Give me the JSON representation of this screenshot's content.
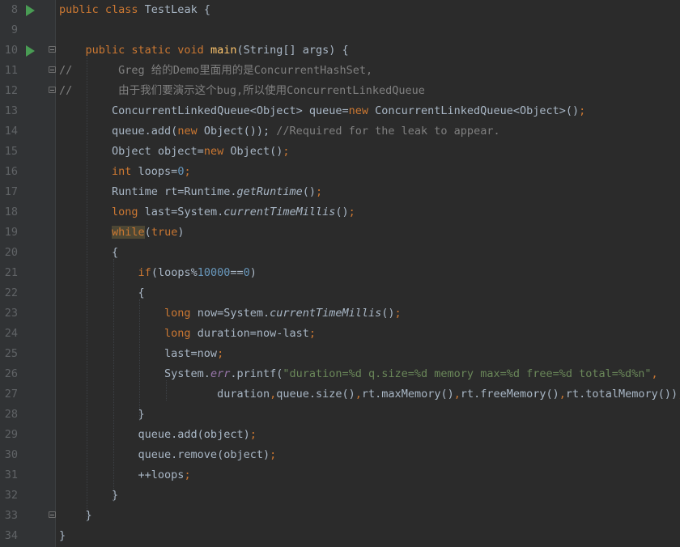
{
  "editor": {
    "colors": {
      "background": "#2b2b2b",
      "gutter": "#313335",
      "keyword": "#cc7832",
      "method": "#ffc66d",
      "number": "#6897bb",
      "string": "#6a8759",
      "comment": "#808080",
      "field": "#9876aa",
      "text": "#a9b7c6",
      "line_number": "#606366",
      "run_icon": "#499c54"
    },
    "lines": [
      {
        "num": "8",
        "parts": [
          [
            "kw",
            "public class "
          ],
          [
            "",
            "TestLeak {"
          ]
        ]
      },
      {
        "num": "9",
        "parts": []
      },
      {
        "num": "10",
        "parts": [
          [
            "",
            "    "
          ],
          [
            "kw",
            "public static void "
          ],
          [
            "fn",
            "main"
          ],
          [
            "",
            "(String[] args) {"
          ]
        ]
      },
      {
        "num": "11",
        "parts": [
          [
            "cmt",
            "//       Greg 给的Demo里面用的是ConcurrentHashSet,"
          ]
        ]
      },
      {
        "num": "12",
        "parts": [
          [
            "cmt",
            "//       由于我们要演示这个bug,所以使用ConcurrentLinkedQueue"
          ]
        ]
      },
      {
        "num": "13",
        "parts": [
          [
            "",
            "        ConcurrentLinkedQueue<Object> queue="
          ],
          [
            "kw",
            "new "
          ],
          [
            "",
            "ConcurrentLinkedQueue<Object>()"
          ],
          [
            "kw",
            ";"
          ]
        ]
      },
      {
        "num": "14",
        "parts": [
          [
            "",
            "        queue.add("
          ],
          [
            "kw",
            "new "
          ],
          [
            "",
            "Object()); "
          ],
          [
            "cmt",
            "//Required for the leak to appear."
          ]
        ]
      },
      {
        "num": "15",
        "parts": [
          [
            "",
            "        Object object="
          ],
          [
            "kw",
            "new "
          ],
          [
            "",
            "Object()"
          ],
          [
            "kw",
            ";"
          ]
        ]
      },
      {
        "num": "16",
        "parts": [
          [
            "",
            "        "
          ],
          [
            "kw",
            "int "
          ],
          [
            "",
            "loops="
          ],
          [
            "num",
            "0"
          ],
          [
            "kw",
            ";"
          ]
        ]
      },
      {
        "num": "17",
        "parts": [
          [
            "",
            "        Runtime rt=Runtime."
          ],
          [
            "static",
            "getRuntime"
          ],
          [
            "",
            "()"
          ],
          [
            "kw",
            ";"
          ]
        ]
      },
      {
        "num": "18",
        "parts": [
          [
            "",
            "        "
          ],
          [
            "kw",
            "long "
          ],
          [
            "",
            "last=System."
          ],
          [
            "static",
            "currentTimeMillis"
          ],
          [
            "",
            "()"
          ],
          [
            "kw",
            ";"
          ]
        ]
      },
      {
        "num": "19",
        "parts": [
          [
            "",
            "        "
          ],
          [
            "kw hl",
            "while"
          ],
          [
            "",
            "("
          ],
          [
            "kw",
            "true"
          ],
          [
            "",
            ")"
          ]
        ]
      },
      {
        "num": "20",
        "parts": [
          [
            "",
            "        {"
          ]
        ]
      },
      {
        "num": "21",
        "parts": [
          [
            "",
            "            "
          ],
          [
            "kw",
            "if"
          ],
          [
            "",
            "(loops%"
          ],
          [
            "num",
            "10000"
          ],
          [
            "",
            "=="
          ],
          [
            "num",
            "0"
          ],
          [
            "",
            ")"
          ]
        ]
      },
      {
        "num": "22",
        "parts": [
          [
            "",
            "            {"
          ]
        ]
      },
      {
        "num": "23",
        "parts": [
          [
            "",
            "                "
          ],
          [
            "kw",
            "long "
          ],
          [
            "",
            "now=System."
          ],
          [
            "static",
            "currentTimeMillis"
          ],
          [
            "",
            "()"
          ],
          [
            "kw",
            ";"
          ]
        ]
      },
      {
        "num": "24",
        "parts": [
          [
            "",
            "                "
          ],
          [
            "kw",
            "long "
          ],
          [
            "",
            "duration=now-last"
          ],
          [
            "kw",
            ";"
          ]
        ]
      },
      {
        "num": "25",
        "parts": [
          [
            "",
            "                last=now"
          ],
          [
            "kw",
            ";"
          ]
        ]
      },
      {
        "num": "26",
        "parts": [
          [
            "",
            "                System."
          ],
          [
            "field",
            "err"
          ],
          [
            "",
            ".printf("
          ],
          [
            "str",
            "\"duration=%d q.size=%d memory max=%d free=%d total=%d%n\""
          ],
          [
            "kw",
            ","
          ]
        ]
      },
      {
        "num": "27",
        "parts": [
          [
            "",
            "                        duration"
          ],
          [
            "kw",
            ","
          ],
          [
            "",
            "queue.size()"
          ],
          [
            "kw",
            ","
          ],
          [
            "",
            "rt.maxMemory()"
          ],
          [
            "kw",
            ","
          ],
          [
            "",
            "rt.freeMemory()"
          ],
          [
            "kw",
            ","
          ],
          [
            "",
            "rt.totalMemory())"
          ],
          [
            "kw",
            ";"
          ]
        ]
      },
      {
        "num": "28",
        "parts": [
          [
            "",
            "            }"
          ]
        ]
      },
      {
        "num": "29",
        "parts": [
          [
            "",
            "            queue.add(object)"
          ],
          [
            "kw",
            ";"
          ]
        ]
      },
      {
        "num": "30",
        "parts": [
          [
            "",
            "            queue.remove(object)"
          ],
          [
            "kw",
            ";"
          ]
        ]
      },
      {
        "num": "31",
        "parts": [
          [
            "",
            "            ++loops"
          ],
          [
            "kw",
            ";"
          ]
        ]
      },
      {
        "num": "32",
        "parts": [
          [
            "",
            "        }"
          ]
        ]
      },
      {
        "num": "33",
        "parts": [
          [
            "",
            "    }"
          ]
        ]
      },
      {
        "num": "34",
        "parts": [
          [
            "",
            "}"
          ]
        ]
      }
    ],
    "gutter_icons": {
      "8": [
        "run-icon"
      ],
      "10": [
        "run-icon",
        "fold-icon"
      ],
      "11": [
        "fold-icon"
      ],
      "12": [
        "fold-icon"
      ],
      "33": [
        "fold-icon"
      ]
    }
  }
}
